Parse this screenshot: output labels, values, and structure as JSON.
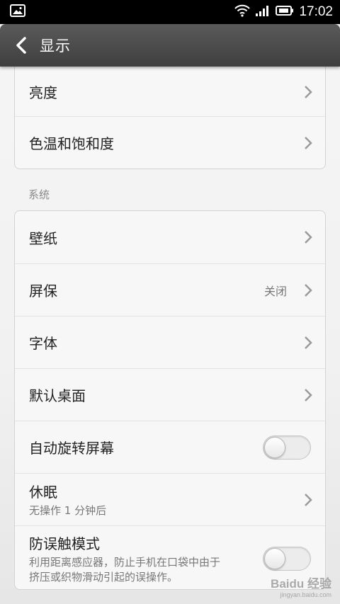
{
  "status_bar": {
    "time": "17:02"
  },
  "title_bar": {
    "title": "显示"
  },
  "group_top": {
    "items": [
      {
        "label": "亮度"
      },
      {
        "label": "色温和饱和度"
      }
    ]
  },
  "section_system": {
    "header": "系统",
    "items": [
      {
        "label": "壁纸"
      },
      {
        "label": "屏保",
        "value": "关闭"
      },
      {
        "label": "字体"
      },
      {
        "label": "默认桌面"
      },
      {
        "label": "自动旋转屏幕",
        "toggle_on": false
      },
      {
        "label": "休眠",
        "sub": "无操作 1 分钟后"
      },
      {
        "label": "防误触模式",
        "sub_line1": "利用距离感应器，防止手机在口袋中由于",
        "sub_line2": "挤压或织物滑动引起的误操作。",
        "toggle_on": false
      }
    ]
  },
  "watermark": {
    "brand": "Baidu 经验",
    "url": "jingyan.baidu.com"
  }
}
